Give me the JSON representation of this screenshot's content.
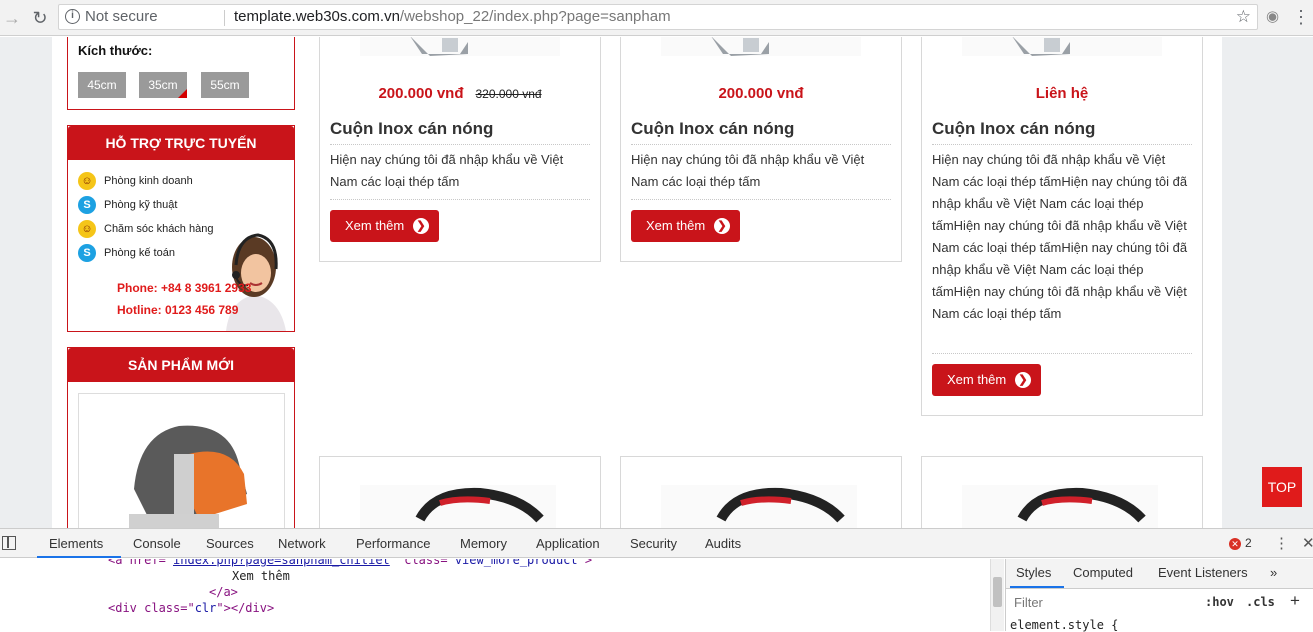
{
  "browser": {
    "security_label": "Not secure",
    "url_host": "template.web30s.com.vn",
    "url_path": "/webshop_22/index.php?page=sanpham"
  },
  "sidebar": {
    "size_title": "Kích thước:",
    "sizes": [
      "45cm",
      "35cm",
      "55cm"
    ],
    "selected_size": "35cm",
    "support": {
      "title": "HỖ TRỢ TRỰC TUYẾN",
      "items": [
        {
          "label": "Phòng kinh doanh",
          "icon": "yahoo-messenger-icon"
        },
        {
          "label": "Phòng kỹ thuật",
          "icon": "skype-icon"
        },
        {
          "label": "Chăm sóc khách hàng",
          "icon": "yahoo-messenger-icon"
        },
        {
          "label": "Phòng kế toán",
          "icon": "skype-icon"
        }
      ],
      "phone": "Phone: +84 8 3961 2933",
      "hotline": "Hotline: 0123 456 789"
    },
    "new_products": {
      "title": "SẢN PHẨM MỚI"
    }
  },
  "products": [
    {
      "price": "200.000 vnđ",
      "old_price": "320.000 vnđ",
      "title": "Cuộn Inox cán nóng",
      "desc": "Hiện nay chúng tôi đã nhập khẩu về Việt Nam các loại thép tấm",
      "button": "Xem thêm"
    },
    {
      "price": "200.000 vnđ",
      "old_price": "",
      "title": "Cuộn Inox cán nóng",
      "desc": "Hiện nay chúng tôi đã nhập khẩu về Việt Nam các loại thép tấm",
      "button": "Xem thêm"
    },
    {
      "price": "Liên hệ",
      "old_price": "",
      "title": "Cuộn Inox cán nóng",
      "desc": "Hiện nay chúng tôi đã nhập khẩu về Việt Nam các loại thép tấmHiện nay chúng tôi đã nhập khẩu về Việt Nam các loại thép tấmHiện nay chúng tôi đã nhập khẩu về Việt Nam các loại thép tấmHiện nay chúng tôi đã nhập khẩu về Việt Nam các loại thép tấmHiện nay chúng tôi đã nhập khẩu về Việt Nam các loại thép tấm",
      "button": "Xem thêm"
    }
  ],
  "top_button": "TOP",
  "devtools": {
    "tabs": [
      "Elements",
      "Console",
      "Sources",
      "Network",
      "Performance",
      "Memory",
      "Application",
      "Security",
      "Audits"
    ],
    "active_tab": "Elements",
    "error_count": "2",
    "code": {
      "line1_tag_open": "<a href=\"",
      "line1_href": "index.php?page=sanpham_chitiet",
      "line1_class_attr": "\" class=\"",
      "line1_class_val": "view_more_product",
      "line1_close": "\">",
      "line2": "Xem thêm",
      "line3": "</a>",
      "line4_open": "<div class=\"",
      "line4_val": "clr",
      "line4_close": "\"></div>"
    },
    "styles_tabs": [
      "Styles",
      "Computed",
      "Event Listeners"
    ],
    "styles_overflow": "»",
    "filter_placeholder": "Filter",
    "hov": ":hov",
    "cls": ".cls",
    "element_style": "element.style {"
  },
  "colors": {
    "brand_red": "#c9141a",
    "devtools_accent": "#1a73e8"
  }
}
